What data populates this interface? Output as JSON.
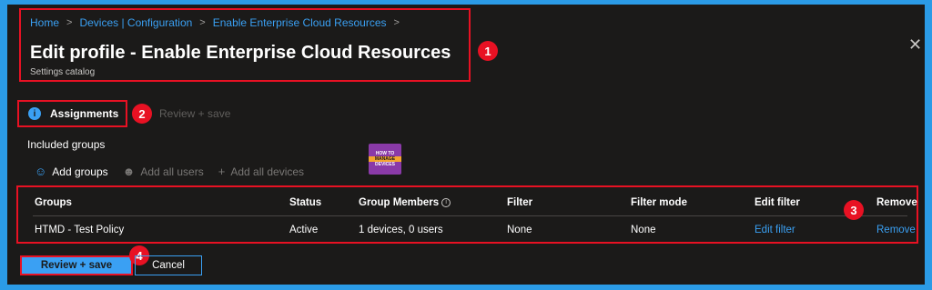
{
  "breadcrumb": [
    "Home",
    "Devices | Configuration",
    "Enable Enterprise Cloud Resources"
  ],
  "header": {
    "title": "Edit profile - Enable Enterprise Cloud Resources",
    "subtitle": "Settings catalog"
  },
  "callouts": [
    "1",
    "2",
    "3",
    "4"
  ],
  "tabs": [
    {
      "label": "Assignments",
      "active": true
    },
    {
      "label": "Review + save",
      "active": false
    }
  ],
  "section_title": "Included groups",
  "logo": {
    "line1": "HOW TO",
    "line2": "MANAGE",
    "line3": "DEVICES"
  },
  "actions": [
    {
      "label": "Add groups",
      "icon": "person-add-icon",
      "enabled": true
    },
    {
      "label": "Add all users",
      "icon": "people-icon",
      "enabled": false
    },
    {
      "label": "Add all devices",
      "icon": "plus-icon",
      "enabled": false
    }
  ],
  "table": {
    "headers": [
      "Groups",
      "Status",
      "Group Members",
      "Filter",
      "Filter mode",
      "Edit filter",
      "Remove"
    ],
    "rows": [
      {
        "group": "HTMD - Test Policy",
        "status": "Active",
        "members": "1 devices, 0 users",
        "filter": "None",
        "filter_mode": "None",
        "edit_filter": "Edit filter",
        "remove": "Remove"
      }
    ]
  },
  "footer": {
    "review_label": "Review + save",
    "cancel_label": "Cancel"
  },
  "colors": {
    "accent": "#3aa0f3",
    "highlight": "#e81123",
    "background": "#1b1a19",
    "border_outer": "#2b9be6"
  }
}
